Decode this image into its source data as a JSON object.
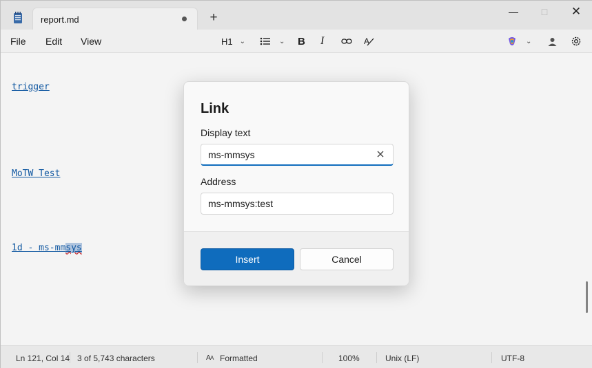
{
  "tab": {
    "title": "report.md"
  },
  "menu": {
    "file": "File",
    "edit": "Edit",
    "view": "View"
  },
  "toolbar": {
    "heading": "H1"
  },
  "editor": {
    "lines": [
      "trigger",
      "MoTW Test",
      "1d - ms-mm",
      "sys"
    ]
  },
  "dialog": {
    "title": "Link",
    "display_text_label": "Display text",
    "display_text_value": "ms-mmsys",
    "address_label": "Address",
    "address_value": "ms-mmsys:test",
    "insert_label": "Insert",
    "cancel_label": "Cancel"
  },
  "status": {
    "position": "Ln 121, Col 14",
    "chars": "3 of 5,743 characters",
    "format": "Formatted",
    "zoom": "100%",
    "line_ending": "Unix (LF)",
    "encoding": "UTF-8"
  },
  "colors": {
    "accent": "#0f6cbd",
    "link": "#0f5aa8"
  },
  "icons": [
    "notepad-icon",
    "bullet-list-icon",
    "bold-icon",
    "italic-icon",
    "link-icon",
    "clear-format-icon",
    "copilot-icon",
    "account-icon",
    "settings-icon",
    "clear-input-icon"
  ]
}
